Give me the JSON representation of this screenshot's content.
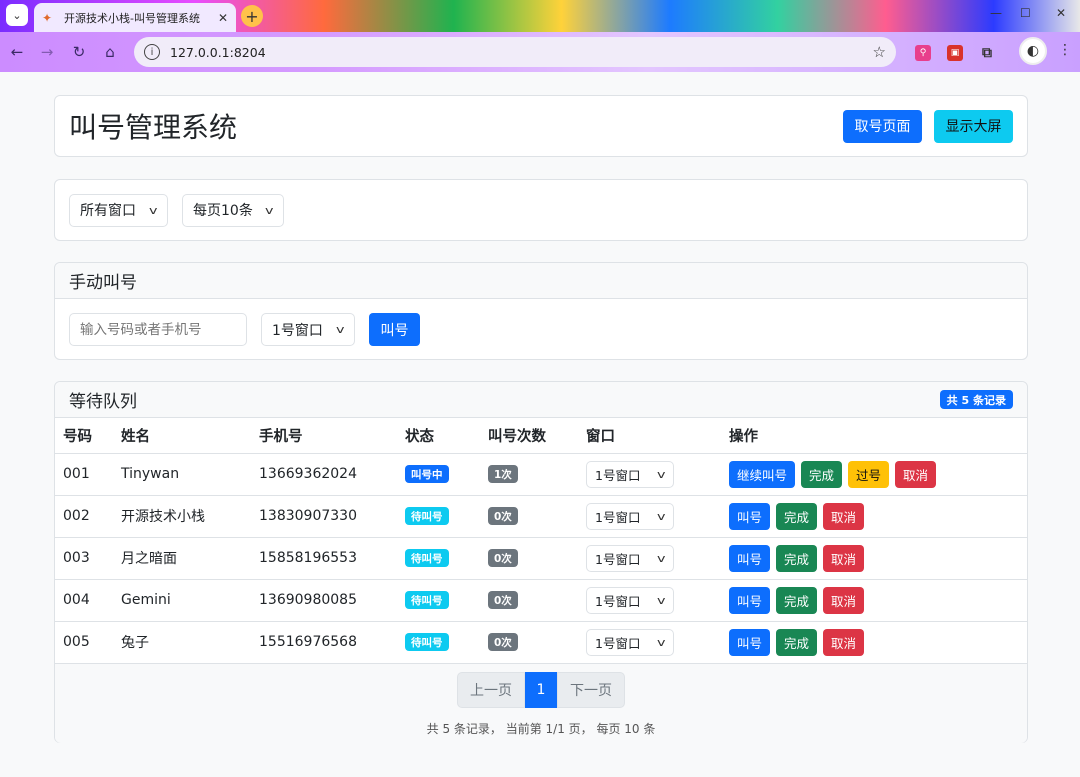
{
  "browser": {
    "tab_title": "开源技术小栈-叫号管理系统",
    "url": "127.0.0.1:8204",
    "tab_close": "✕",
    "new_tab": "+"
  },
  "header": {
    "title": "叫号管理系统",
    "take_number_label": "取号页面",
    "big_screen_label": "显示大屏"
  },
  "filters": {
    "window_filter": "所有窗口",
    "page_size": "每页10条"
  },
  "manual_call": {
    "title": "手动叫号",
    "input_placeholder": "输入号码或者手机号",
    "window_select": "1号窗口",
    "call_label": "叫号"
  },
  "queue": {
    "title": "等待队列",
    "record_badge": "共 5 条记录",
    "columns": [
      "号码",
      "姓名",
      "手机号",
      "状态",
      "叫号次数",
      "窗口",
      "操作"
    ],
    "rows": [
      {
        "number": "001",
        "name": "Tinywan",
        "phone": "13669362024",
        "status": "叫号中",
        "status_color": "#0d6efd",
        "count": "1次",
        "window": "1号窗口",
        "actions": [
          {
            "label": "继续叫号",
            "color": "#0d6efd"
          },
          {
            "label": "完成",
            "color": "#198754"
          },
          {
            "label": "过号",
            "color": "#ffc107"
          },
          {
            "label": "取消",
            "color": "#dc3545"
          }
        ]
      },
      {
        "number": "002",
        "name": "开源技术小栈",
        "phone": "13830907330",
        "status": "待叫号",
        "status_color": "#0dcaf0",
        "count": "0次",
        "window": "1号窗口",
        "actions": [
          {
            "label": "叫号",
            "color": "#0d6efd"
          },
          {
            "label": "完成",
            "color": "#198754"
          },
          {
            "label": "取消",
            "color": "#dc3545"
          }
        ]
      },
      {
        "number": "003",
        "name": "月之暗面",
        "phone": "15858196553",
        "status": "待叫号",
        "status_color": "#0dcaf0",
        "count": "0次",
        "window": "1号窗口",
        "actions": [
          {
            "label": "叫号",
            "color": "#0d6efd"
          },
          {
            "label": "完成",
            "color": "#198754"
          },
          {
            "label": "取消",
            "color": "#dc3545"
          }
        ]
      },
      {
        "number": "004",
        "name": "Gemini",
        "phone": "13690980085",
        "status": "待叫号",
        "status_color": "#0dcaf0",
        "count": "0次",
        "window": "1号窗口",
        "actions": [
          {
            "label": "叫号",
            "color": "#0d6efd"
          },
          {
            "label": "完成",
            "color": "#198754"
          },
          {
            "label": "取消",
            "color": "#dc3545"
          }
        ]
      },
      {
        "number": "005",
        "name": "兔子",
        "phone": "15516976568",
        "status": "待叫号",
        "status_color": "#0dcaf0",
        "count": "0次",
        "window": "1号窗口",
        "actions": [
          {
            "label": "叫号",
            "color": "#0d6efd"
          },
          {
            "label": "完成",
            "color": "#198754"
          },
          {
            "label": "取消",
            "color": "#dc3545"
          }
        ]
      }
    ]
  },
  "pagination": {
    "prev": "上一页",
    "current": "1",
    "next": "下一页",
    "summary": "共 5 条记录， 当前第 1/1 页， 每页 10 条"
  },
  "colors": {
    "primary": "#0d6efd",
    "info": "#0dcaf0",
    "success": "#198754",
    "warning": "#ffc107",
    "danger": "#dc3545",
    "secondary": "#6c757d"
  }
}
